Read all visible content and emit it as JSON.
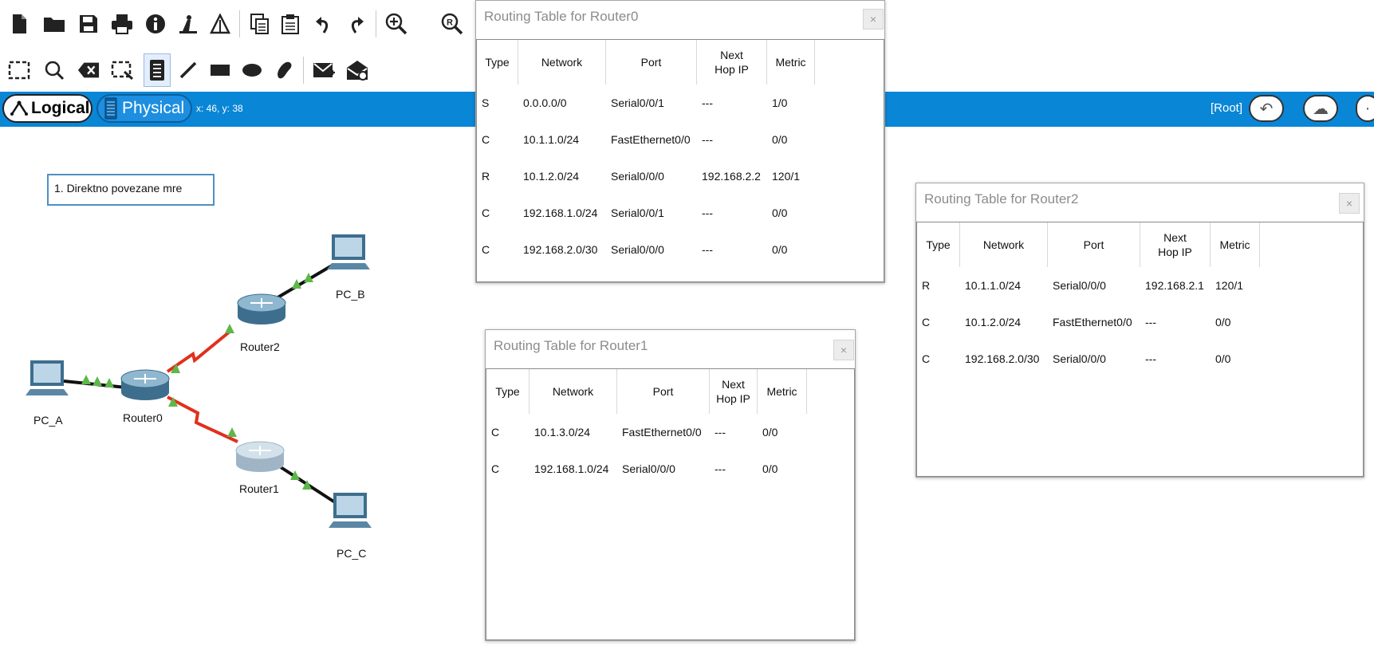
{
  "toolbar1": {
    "icons": [
      "new-file-icon",
      "open-folder-icon",
      "save-icon",
      "print-icon",
      "info-icon",
      "activity-wizard-icon",
      "network-info-icon",
      "copy-icon",
      "paste-icon",
      "undo-icon",
      "redo-icon",
      "zoom-in-icon",
      "zoom-reset-icon"
    ]
  },
  "toolbar2": {
    "icons": [
      "select-icon",
      "inspect-icon",
      "delete-icon",
      "resize-icon",
      "note-icon",
      "line-icon",
      "rectangle-icon",
      "ellipse-icon",
      "freeform-icon",
      "simple-pdu-icon",
      "complex-pdu-icon"
    ]
  },
  "modebar": {
    "logical_label": "Logical",
    "physical_label": "Physical",
    "coords": "x: 46, y: 38",
    "root_label": "[Root]"
  },
  "workspace": {
    "note_text": "1. Direktno povezane mre",
    "devices": {
      "pc_a": "PC_A",
      "pc_b": "PC_B",
      "pc_c": "PC_C",
      "router0": "Router0",
      "router1": "Router1",
      "router2": "Router2"
    }
  },
  "tables": {
    "r0": {
      "title": "Routing Table for Router0",
      "headers": [
        "Type",
        "Network",
        "Port",
        "Next\nHop IP",
        "Metric"
      ],
      "rows": [
        [
          "S",
          "0.0.0.0/0",
          "Serial0/0/1",
          "---",
          "1/0"
        ],
        [
          "C",
          "10.1.1.0/24",
          "FastEthernet0/0",
          "---",
          "0/0"
        ],
        [
          "R",
          "10.1.2.0/24",
          "Serial0/0/0",
          "192.168.2.2",
          "120/1"
        ],
        [
          "C",
          "192.168.1.0/24",
          "Serial0/0/1",
          "---",
          "0/0"
        ],
        [
          "C",
          "192.168.2.0/30",
          "Serial0/0/0",
          "---",
          "0/0"
        ]
      ]
    },
    "r1": {
      "title": "Routing Table for Router1",
      "headers": [
        "Type",
        "Network",
        "Port",
        "Next\nHop IP",
        "Metric"
      ],
      "rows": [
        [
          "C",
          "10.1.3.0/24",
          "FastEthernet0/0",
          "---",
          "0/0"
        ],
        [
          "C",
          "192.168.1.0/24",
          "Serial0/0/0",
          "---",
          "0/0"
        ]
      ]
    },
    "r2": {
      "title": "Routing Table for Router2",
      "headers": [
        "Type",
        "Network",
        "Port",
        "Next\nHop IP",
        "Metric"
      ],
      "rows": [
        [
          "R",
          "10.1.1.0/24",
          "Serial0/0/0",
          "192.168.2.1",
          "120/1"
        ],
        [
          "C",
          "10.1.2.0/24",
          "FastEthernet0/0",
          "---",
          "0/0"
        ],
        [
          "C",
          "192.168.2.0/30",
          "Serial0/0/0",
          "---",
          "0/0"
        ]
      ]
    }
  },
  "colors": {
    "accent": "#0a86d6",
    "serial_link": "#e0301e",
    "ethernet_link": "#111111",
    "link_light": "#5cb848"
  }
}
